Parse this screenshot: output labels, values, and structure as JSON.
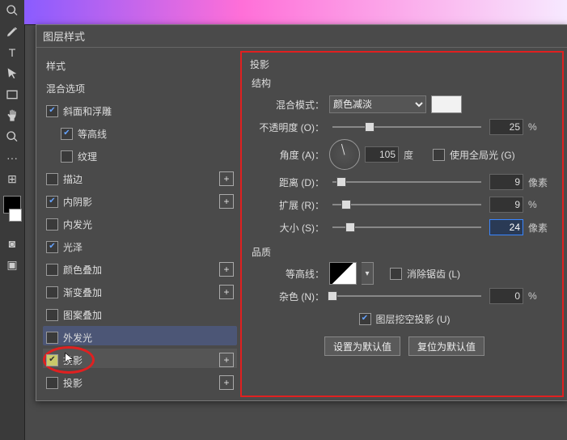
{
  "dialog": {
    "title": "图层样式"
  },
  "styles": {
    "header": "样式",
    "blending": "混合选项",
    "items": [
      {
        "label": "斜面和浮雕",
        "checked": true,
        "plus": false
      },
      {
        "label": "等高线",
        "checked": true,
        "plus": false,
        "sub": true
      },
      {
        "label": "纹理",
        "checked": false,
        "plus": false,
        "sub": true
      },
      {
        "label": "描边",
        "checked": false,
        "plus": true
      },
      {
        "label": "内阴影",
        "checked": true,
        "plus": true
      },
      {
        "label": "内发光",
        "checked": false,
        "plus": false
      },
      {
        "label": "光泽",
        "checked": true,
        "plus": false
      },
      {
        "label": "颜色叠加",
        "checked": false,
        "plus": true
      },
      {
        "label": "渐变叠加",
        "checked": false,
        "plus": true
      },
      {
        "label": "图案叠加",
        "checked": false,
        "plus": false
      },
      {
        "label": "外发光",
        "checked": false,
        "plus": false,
        "hl": true
      },
      {
        "label": "投影",
        "checked": true,
        "plus": true,
        "sel": true
      },
      {
        "label": "投影",
        "checked": false,
        "plus": true
      }
    ]
  },
  "drop_shadow": {
    "title": "投影",
    "structure": "结构",
    "blend_mode_label": "混合模式：",
    "blend_mode": "颜色减淡",
    "opacity_label": "不透明度 (O)：",
    "opacity": 25,
    "opacity_unit": "%",
    "angle_label": "角度 (A)：",
    "angle": 105,
    "angle_unit": "度",
    "global_light_label": "使用全局光 (G)",
    "global_light": false,
    "distance_label": "距离 (D)：",
    "distance": 9,
    "px": "像素",
    "spread_label": "扩展 (R)：",
    "spread": 9,
    "pct": "%",
    "size_label": "大小 (S)：",
    "size": 24,
    "quality": "品质",
    "contour_label": "等高线：",
    "antialias_label": "消除锯齿 (L)",
    "antialias": false,
    "noise_label": "杂色 (N)：",
    "noise": 0,
    "noise_unit": "%",
    "knockout_label": "图层挖空投影 (U)",
    "knockout": true,
    "btn_default": "设置为默认值",
    "btn_reset": "复位为默认值"
  }
}
